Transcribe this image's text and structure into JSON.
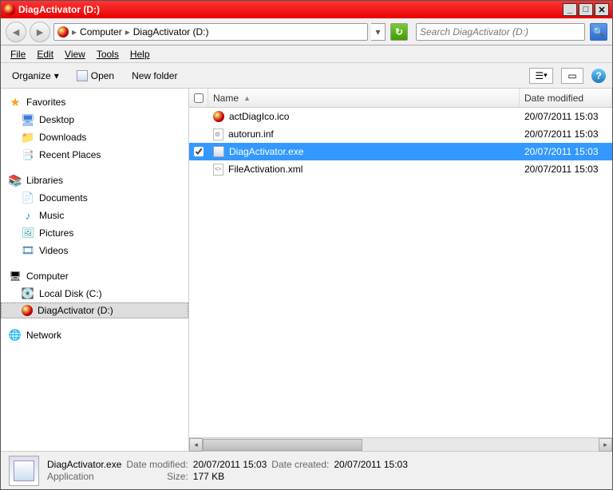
{
  "window": {
    "title": "DiagActivator (D:)"
  },
  "breadcrumb": {
    "root": "Computer",
    "current": "DiagActivator (D:)"
  },
  "search": {
    "placeholder": "Search DiagActivator (D:)"
  },
  "menu": {
    "file": "File",
    "edit": "Edit",
    "view": "View",
    "tools": "Tools",
    "help": "Help"
  },
  "toolbar": {
    "organize": "Organize",
    "open": "Open",
    "newfolder": "New folder"
  },
  "sidebar": {
    "favorites": {
      "label": "Favorites",
      "items": [
        {
          "label": "Desktop"
        },
        {
          "label": "Downloads"
        },
        {
          "label": "Recent Places"
        }
      ]
    },
    "libraries": {
      "label": "Libraries",
      "items": [
        {
          "label": "Documents"
        },
        {
          "label": "Music"
        },
        {
          "label": "Pictures"
        },
        {
          "label": "Videos"
        }
      ]
    },
    "computer": {
      "label": "Computer",
      "items": [
        {
          "label": "Local Disk (C:)"
        },
        {
          "label": "DiagActivator (D:)"
        }
      ]
    },
    "network": {
      "label": "Network"
    }
  },
  "columns": {
    "name": "Name",
    "date": "Date modified"
  },
  "files": [
    {
      "name": "actDiagIco.ico",
      "date": "20/07/2011 15:03",
      "icon": "red",
      "selected": false
    },
    {
      "name": "autorun.inf",
      "date": "20/07/2011 15:03",
      "icon": "ini",
      "selected": false
    },
    {
      "name": "DiagActivator.exe",
      "date": "20/07/2011 15:03",
      "icon": "exe",
      "selected": true
    },
    {
      "name": "FileActivation.xml",
      "date": "20/07/2011 15:03",
      "icon": "xml",
      "selected": false
    }
  ],
  "details": {
    "name": "DiagActivator.exe",
    "type": "Application",
    "modified_label": "Date modified:",
    "modified": "20/07/2011 15:03",
    "created_label": "Date created:",
    "created": "20/07/2011 15:03",
    "size_label": "Size:",
    "size": "177 KB"
  }
}
